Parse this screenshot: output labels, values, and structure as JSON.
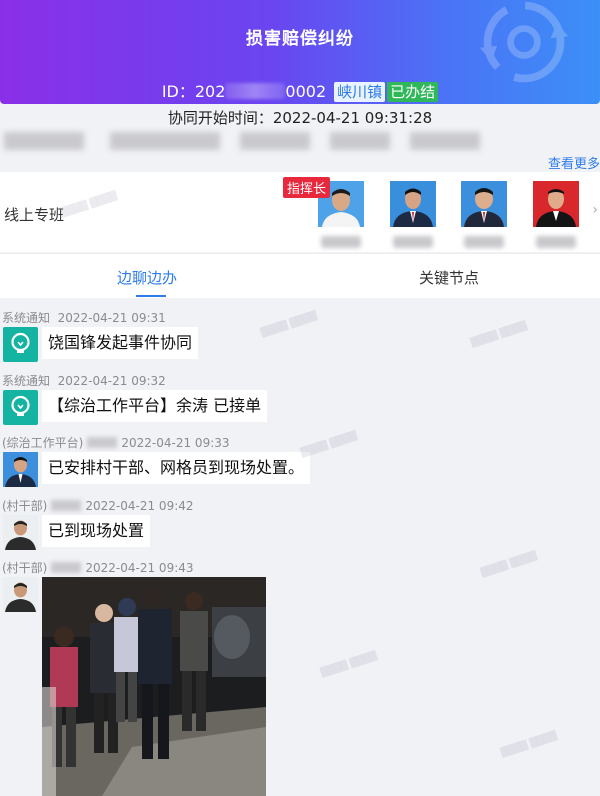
{
  "header": {
    "title": "损害赔偿纠纷",
    "id_prefix": "ID：202",
    "id_suffix": "0002",
    "town_badge": "峡川镇",
    "status_badge": "已办结"
  },
  "info": {
    "start_time": "协同开始时间：2022-04-21 09:31:28",
    "see_more": "查看更多"
  },
  "team": {
    "label": "线上专班",
    "chief_tag": "指挥长"
  },
  "tabs": [
    {
      "label": "边聊边办"
    },
    {
      "label": "关键节点"
    }
  ],
  "messages": [
    {
      "sender": "系统通知",
      "time": "2022-04-21 09:31",
      "text": "饶国锋发起事件协同"
    },
    {
      "sender": "系统通知",
      "time": "2022-04-21 09:32",
      "text": "【综治工作平台】余涛 已接单"
    },
    {
      "sender": "(综治工作平台)",
      "time": "2022-04-21 09:33",
      "text": "已安排村干部、网格员到现场处置。"
    },
    {
      "sender": "(村干部)",
      "time": "2022-04-21 09:42",
      "text": "已到现场处置"
    },
    {
      "sender": "(村干部)",
      "time": "2022-04-21 09:43",
      "text": ""
    }
  ],
  "colors": {
    "accent": "#2e7de9",
    "chief_red": "#e8283c",
    "done_green": "#2fb85a",
    "system_teal": "#14b3a2"
  }
}
